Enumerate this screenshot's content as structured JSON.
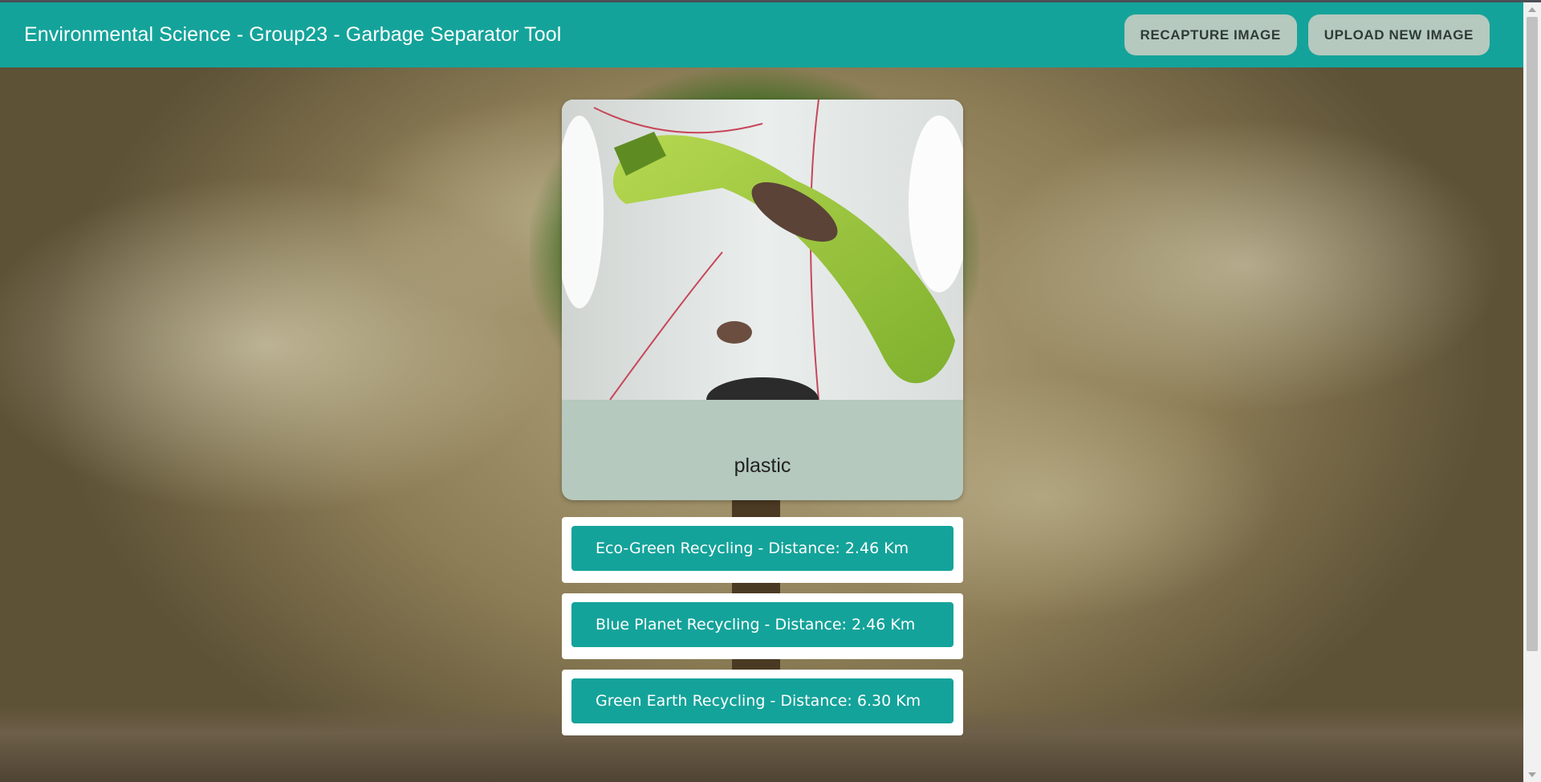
{
  "header": {
    "title": "Environmental Science - Group23 - Garbage Separator Tool",
    "recapture_label": "RECAPTURE IMAGE",
    "upload_label": "UPLOAD NEW IMAGE"
  },
  "result": {
    "label": "plastic",
    "image_icon": "captured-bottle-photo"
  },
  "recyclers": [
    {
      "label": "Eco-Green Recycling - Distance: 2.46 Km"
    },
    {
      "label": "Blue Planet Recycling - Distance: 2.46 Km"
    },
    {
      "label": "Green Earth Recycling - Distance: 6.30 Km"
    }
  ],
  "colors": {
    "header": "#14a39a",
    "button_bg": "#b5c9be",
    "list_button": "#14a39a"
  }
}
